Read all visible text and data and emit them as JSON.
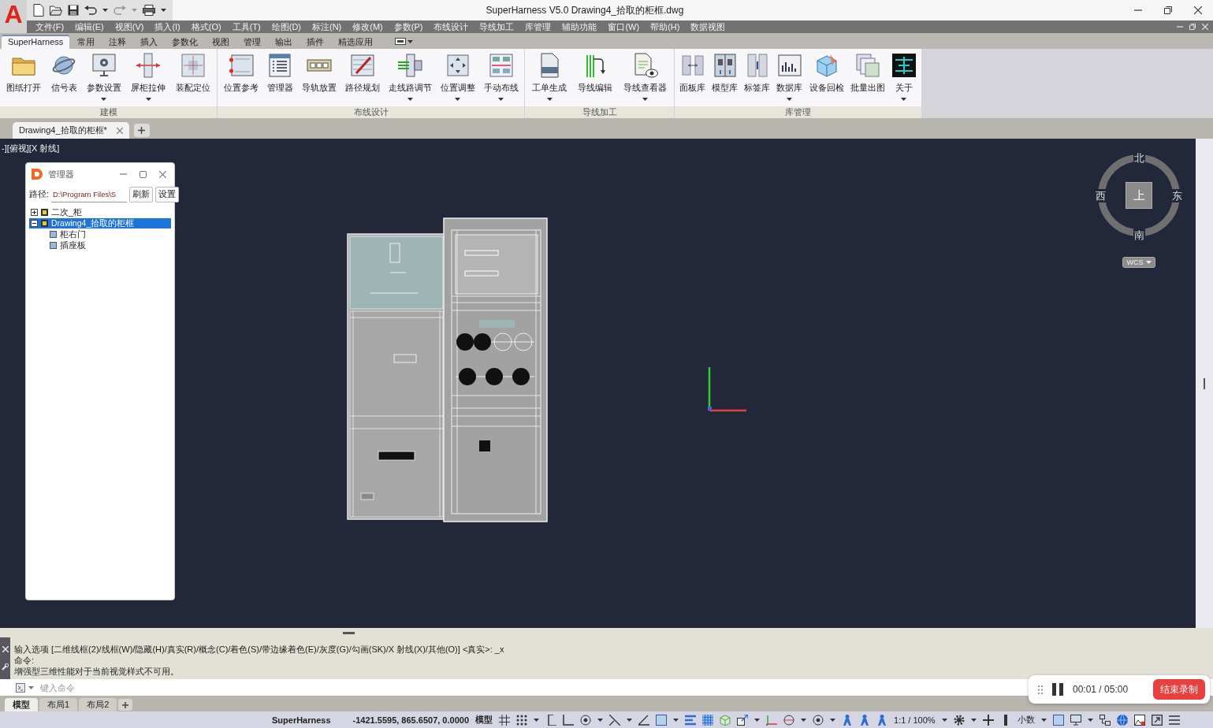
{
  "title_bar": {
    "logo": "A",
    "title": "SuperHarness V5.0    Drawing4_拾取的柜框.dwg"
  },
  "menu_bar": {
    "items": [
      "文件(F)",
      "编辑(E)",
      "视图(V)",
      "插入(I)",
      "格式(O)",
      "工具(T)",
      "绘图(D)",
      "标注(N)",
      "修改(M)",
      "参数(P)",
      "布线设计",
      "导线加工",
      "库管理",
      "辅助功能",
      "窗口(W)",
      "帮助(H)",
      "数据视图"
    ]
  },
  "ribbon": {
    "tabs": [
      {
        "label": "SuperHarness",
        "selected": true
      },
      {
        "label": "常用",
        "selected": false
      },
      {
        "label": "注释",
        "selected": false
      },
      {
        "label": "插入",
        "selected": false
      },
      {
        "label": "参数化",
        "selected": false
      },
      {
        "label": "视图",
        "selected": false
      },
      {
        "label": "管理",
        "selected": false
      },
      {
        "label": "输出",
        "selected": false
      },
      {
        "label": "插件",
        "selected": false
      },
      {
        "label": "精选应用",
        "selected": false
      }
    ],
    "groups": [
      {
        "label": "建模",
        "buttons": [
          {
            "label": "图纸打开",
            "dropdown": false
          },
          {
            "label": "信号表",
            "dropdown": false
          },
          {
            "label": "参数设置",
            "dropdown": true
          },
          {
            "label": "屏柜拉伸",
            "dropdown": true
          },
          {
            "label": "装配定位",
            "dropdown": false
          }
        ]
      },
      {
        "label": "布线设计",
        "buttons": [
          {
            "label": "位置参考",
            "dropdown": false
          },
          {
            "label": "管理器",
            "dropdown": false
          },
          {
            "label": "导轨放置",
            "dropdown": false
          },
          {
            "label": "路径规划",
            "dropdown": false
          },
          {
            "label": "走线路调节",
            "dropdown": true
          },
          {
            "label": "位置调整",
            "dropdown": true
          },
          {
            "label": "手动布线",
            "dropdown": true
          }
        ]
      },
      {
        "label": "导线加工",
        "buttons": [
          {
            "label": "工单生成",
            "dropdown": true
          },
          {
            "label": "导线编辑",
            "dropdown": false
          },
          {
            "label": "导线查看器",
            "dropdown": true
          }
        ]
      },
      {
        "label": "库管理",
        "buttons": [
          {
            "label": "面板库",
            "dropdown": false
          },
          {
            "label": "模型库",
            "dropdown": false
          },
          {
            "label": "标签库",
            "dropdown": false
          },
          {
            "label": "数据库",
            "dropdown": true
          },
          {
            "label": "设备回检",
            "dropdown": false
          },
          {
            "label": "批量出图",
            "dropdown": false
          },
          {
            "label": "关于",
            "dropdown": true
          }
        ]
      }
    ]
  },
  "document_tabs": [
    {
      "label": "Drawing4_拾取的柜框*",
      "selected": true
    }
  ],
  "viewport": {
    "label": "-][俯视][X 射线]",
    "compass": {
      "north": "北",
      "west": "西",
      "east": "东",
      "south": "南",
      "face": "上",
      "ucs": "WCS"
    }
  },
  "manager_panel": {
    "title": "管理器",
    "path_label": "路径:",
    "path_value": "D:\\Program Files\\S",
    "buttons": [
      "刷新",
      "设置"
    ],
    "tree": [
      {
        "label": "二次_柜",
        "expanded": false,
        "selected": false
      },
      {
        "label": "Drawing4_拾取的柜框",
        "expanded": true,
        "selected": true,
        "children": [
          {
            "label": "柜右门",
            "selected": false
          },
          {
            "label": "插座板",
            "selected": false
          }
        ]
      }
    ]
  },
  "command_line": {
    "history": [
      "输入选项 [二维线框(2)/线框(W)/隐藏(H)/真实(R)/概念(C)/着色(S)/带边缘着色(E)/灰度(G)/勾画(SK)/X 射线(X)/其他(O)] <真实>: _x",
      "命令:",
      "增强型三维性能对于当前视觉样式不可用。"
    ],
    "placeholder": "键入命令"
  },
  "layout_tabs": [
    {
      "label": "模型",
      "selected": true
    },
    {
      "label": "布局1",
      "selected": false
    },
    {
      "label": "布局2",
      "selected": false
    }
  ],
  "status_bar": {
    "app_name": "SuperHarness",
    "coordinates": "-1421.5595, 865.6507, 0.0000",
    "space": "模型",
    "annotation_scale": "1:1 / 100%",
    "units": "小数"
  },
  "recorder": {
    "time": "00:01 / 05:00",
    "stop_button": "结束录制"
  }
}
